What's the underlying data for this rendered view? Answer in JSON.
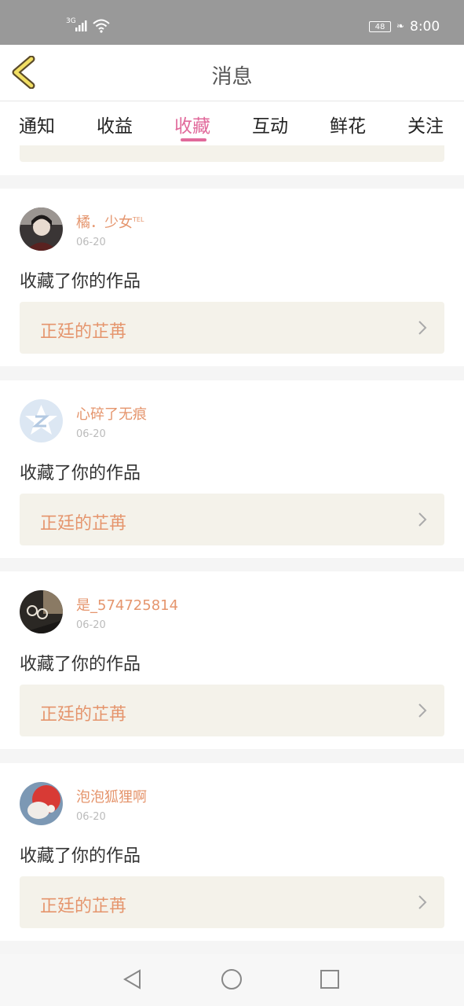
{
  "status_bar": {
    "network": "3G",
    "battery": "48",
    "time": "8:00"
  },
  "header": {
    "title": "消息"
  },
  "tabs": [
    {
      "label": "通知",
      "active": false
    },
    {
      "label": "收益",
      "active": false
    },
    {
      "label": "收藏",
      "active": true
    },
    {
      "label": "互动",
      "active": false
    },
    {
      "label": "鲜花",
      "active": false
    },
    {
      "label": "关注",
      "active": false
    }
  ],
  "accent_color": "#e16a9b",
  "name_color": "#e5956d",
  "items": [
    {
      "user": "橘．少女",
      "badge": "TEL",
      "date": "06-20",
      "action": "收藏了你的作品",
      "work": "正廷的芷苒"
    },
    {
      "user": "心碎了无痕",
      "date": "06-20",
      "action": "收藏了你的作品",
      "work": "正廷的芷苒"
    },
    {
      "user": "是_574725814",
      "date": "06-20",
      "action": "收藏了你的作品",
      "work": "正廷的芷苒"
    },
    {
      "user": "泡泡狐狸啊",
      "date": "06-20",
      "action": "收藏了你的作品",
      "work": "正廷的芷苒"
    }
  ],
  "icons": [
    "back-chevron-icon",
    "chevron-right-icon",
    "nav-back-icon",
    "nav-home-icon",
    "nav-recent-icon"
  ]
}
